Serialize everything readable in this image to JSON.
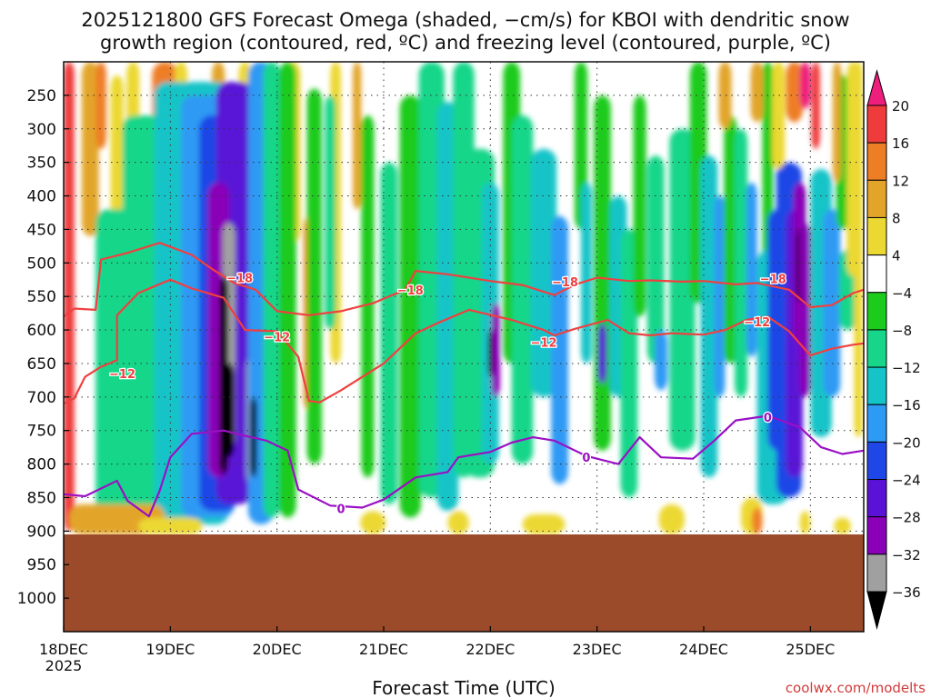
{
  "chart_data": {
    "type": "heatmap",
    "title_line1": "2025121800 GFS Forecast Omega (shaded, −cm/s) for KBOI with dendritic snow",
    "title_line2": "growth region (contoured, red, ºC) and freezing level (contoured, purple, ºC)",
    "xlabel": "Forecast Time (UTC)",
    "credit": "coolwx.com/modelts",
    "x_ticks": [
      "18DEC",
      "19DEC",
      "20DEC",
      "21DEC",
      "22DEC",
      "23DEC",
      "24DEC",
      "25DEC"
    ],
    "x_year": "2025",
    "xlim": [
      0,
      7.5
    ],
    "y_ticks": [
      250,
      300,
      350,
      400,
      450,
      500,
      550,
      600,
      650,
      700,
      750,
      800,
      850,
      900,
      950,
      1000
    ],
    "ylim": [
      200,
      1050
    ],
    "ground_pressure": 905,
    "colorbar": {
      "labels": [
        "20",
        "16",
        "12",
        "8",
        "4",
        "−4",
        "−8",
        "−12",
        "−16",
        "−20",
        "−24",
        "−28",
        "−32",
        "−36"
      ],
      "colors": [
        "#000000",
        "#a0a0a0",
        "#8a00b8",
        "#5a12d6",
        "#1f46e6",
        "#2d9af4",
        "#14c4c8",
        "#17d68a",
        "#1dcb1d",
        "#ffffff",
        "#ecd833",
        "#e2a52a",
        "#ee7e25",
        "#ef3b3b",
        "#ee1e7c"
      ]
    },
    "freezing_level": {
      "name": "0",
      "color": "#9a10c4",
      "label_positions": [
        [
          2.6,
          866
        ],
        [
          4.9,
          790
        ],
        [
          6.6,
          730
        ]
      ],
      "points": [
        [
          0,
          845
        ],
        [
          0.2,
          848
        ],
        [
          0.5,
          825
        ],
        [
          0.6,
          855
        ],
        [
          0.8,
          878
        ],
        [
          0.9,
          840
        ],
        [
          1.0,
          790
        ],
        [
          1.2,
          755
        ],
        [
          1.5,
          750
        ],
        [
          1.7,
          758
        ],
        [
          1.9,
          765
        ],
        [
          2.1,
          780
        ],
        [
          2.2,
          838
        ],
        [
          2.5,
          862
        ],
        [
          2.8,
          865
        ],
        [
          3.0,
          853
        ],
        [
          3.3,
          820
        ],
        [
          3.6,
          812
        ],
        [
          3.7,
          790
        ],
        [
          4.0,
          782
        ],
        [
          4.2,
          768
        ],
        [
          4.4,
          760
        ],
        [
          4.6,
          765
        ],
        [
          4.9,
          788
        ],
        [
          5.2,
          800
        ],
        [
          5.4,
          760
        ],
        [
          5.6,
          790
        ],
        [
          5.9,
          792
        ],
        [
          6.1,
          765
        ],
        [
          6.3,
          735
        ],
        [
          6.6,
          728
        ],
        [
          6.9,
          745
        ],
        [
          7.1,
          775
        ],
        [
          7.3,
          785
        ],
        [
          7.5,
          780
        ]
      ]
    },
    "dgz_contours": [
      {
        "name": "−12",
        "color": "#ef4040",
        "label_positions": [
          [
            0.55,
            665
          ],
          [
            2.0,
            610
          ],
          [
            4.5,
            618
          ],
          [
            6.5,
            588
          ]
        ],
        "points": [
          [
            0,
            710
          ],
          [
            0.1,
            702
          ],
          [
            0.2,
            670
          ],
          [
            0.35,
            655
          ],
          [
            0.5,
            645
          ],
          [
            0.5,
            578
          ],
          [
            0.7,
            545
          ],
          [
            1.0,
            525
          ],
          [
            1.2,
            538
          ],
          [
            1.5,
            552
          ],
          [
            1.7,
            600
          ],
          [
            2.0,
            602
          ],
          [
            2.2,
            640
          ],
          [
            2.3,
            706
          ],
          [
            2.4,
            708
          ],
          [
            2.6,
            690
          ],
          [
            3.0,
            650
          ],
          [
            3.3,
            605
          ],
          [
            3.5,
            590
          ],
          [
            3.8,
            570
          ],
          [
            4.2,
            585
          ],
          [
            4.5,
            600
          ],
          [
            4.6,
            608
          ],
          [
            4.8,
            598
          ],
          [
            5.1,
            585
          ],
          [
            5.3,
            605
          ],
          [
            5.5,
            608
          ],
          [
            5.7,
            605
          ],
          [
            6.0,
            607
          ],
          [
            6.2,
            600
          ],
          [
            6.4,
            585
          ],
          [
            6.6,
            580
          ],
          [
            6.8,
            602
          ],
          [
            7.0,
            638
          ],
          [
            7.2,
            628
          ],
          [
            7.4,
            622
          ],
          [
            7.5,
            620
          ]
        ]
      },
      {
        "name": "−18",
        "color": "#ef4040",
        "label_positions": [
          [
            1.65,
            522
          ],
          [
            3.25,
            540
          ],
          [
            4.7,
            528
          ],
          [
            6.65,
            523
          ]
        ],
        "points": [
          [
            0,
            580
          ],
          [
            0.1,
            568
          ],
          [
            0.3,
            570
          ],
          [
            0.35,
            495
          ],
          [
            0.6,
            485
          ],
          [
            0.9,
            470
          ],
          [
            1.2,
            488
          ],
          [
            1.4,
            510
          ],
          [
            1.6,
            530
          ],
          [
            1.8,
            540
          ],
          [
            2.0,
            572
          ],
          [
            2.3,
            578
          ],
          [
            2.6,
            572
          ],
          [
            2.9,
            560
          ],
          [
            3.2,
            540
          ],
          [
            3.3,
            512
          ],
          [
            3.6,
            517
          ],
          [
            4.0,
            527
          ],
          [
            4.3,
            533
          ],
          [
            4.6,
            548
          ],
          [
            4.8,
            532
          ],
          [
            5.0,
            522
          ],
          [
            5.3,
            527
          ],
          [
            5.5,
            526
          ],
          [
            5.8,
            528
          ],
          [
            6.0,
            527
          ],
          [
            6.3,
            532
          ],
          [
            6.5,
            530
          ],
          [
            6.8,
            540
          ],
          [
            7.0,
            566
          ],
          [
            7.2,
            563
          ],
          [
            7.4,
            545
          ],
          [
            7.5,
            540
          ]
        ]
      }
    ]
  }
}
